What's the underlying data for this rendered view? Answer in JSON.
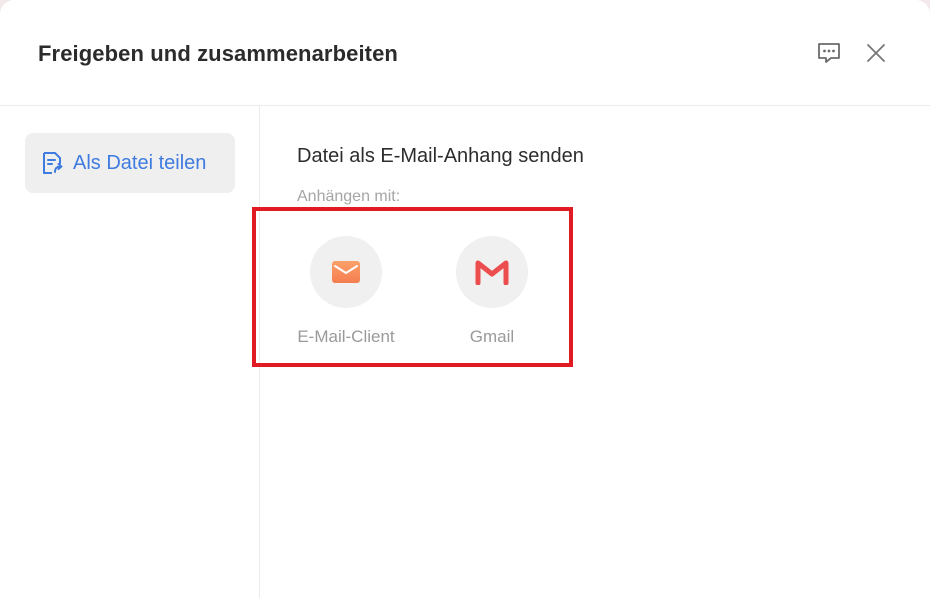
{
  "dialog": {
    "title": "Freigeben und zusammenarbeiten",
    "feedback_icon": "chat-feedback-icon",
    "close_icon": "close-icon"
  },
  "sidebar": {
    "items": [
      {
        "label": "Als Datei teilen",
        "icon": "file-share-icon",
        "selected": true
      }
    ]
  },
  "main": {
    "section_title": "Datei als E-Mail-Anhang senden",
    "attach_label": "Anhängen mit:",
    "apps": [
      {
        "label": "E-Mail-Client",
        "icon": "envelope-icon",
        "color": "#f7895a"
      },
      {
        "label": "Gmail",
        "icon": "gmail-icon",
        "color": "#ec4d4d"
      }
    ]
  },
  "colors": {
    "accent": "#3f7be0",
    "highlight": "#e01b24"
  }
}
